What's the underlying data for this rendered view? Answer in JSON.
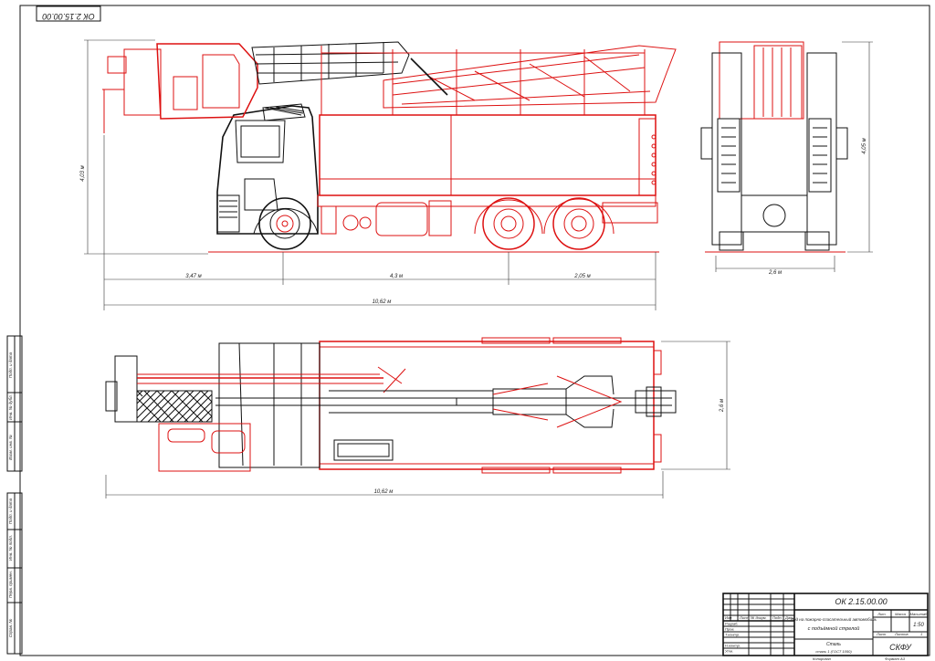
{
  "drawing": {
    "stamp_code": "ОК 2.15.00.00",
    "dimensions": {
      "boom_overhang": "3,47 м",
      "wheelbase": "4,3 м",
      "rear_axles": "2,05 м",
      "overall_length": "10,62 м",
      "overall_length_plan": "10,62 м",
      "overall_height": "4,03 м",
      "rear_height": "4,05 м",
      "rear_width": "2,6 м",
      "plan_width": "2,6 м"
    },
    "margin_labels": [
      "Подп. и дата",
      "Инв. № дубл.",
      "Взам. инв. №",
      "Подп. и дата",
      "Инв. № подл.",
      "Перв. примен.",
      "Справ. №"
    ]
  },
  "title_block": {
    "designation": "ОК 2.15.00.00",
    "name_line1": "Вид на пожарно-спасательный автомобиль",
    "name_line2": "с подъёмной стрелой",
    "row_labels": [
      "Изм",
      "Лист",
      "№ докум.",
      "Подп.",
      "Дата"
    ],
    "staff_labels": [
      "Разраб.",
      "Пров.",
      "Т.контр.",
      "Н.контр.",
      "Утв."
    ],
    "col_labels": [
      "Лит.",
      "Масса",
      "Масштаб"
    ],
    "scale": "1:50",
    "sheet_label": "Лист",
    "sheets_label": "Листов",
    "sheets_count": "1",
    "organization": "СКФУ",
    "format": "Формат А3",
    "copied": "Копировал",
    "material": "Сталь",
    "material_note": "сталь 1 (ГОСТ 1050)"
  }
}
